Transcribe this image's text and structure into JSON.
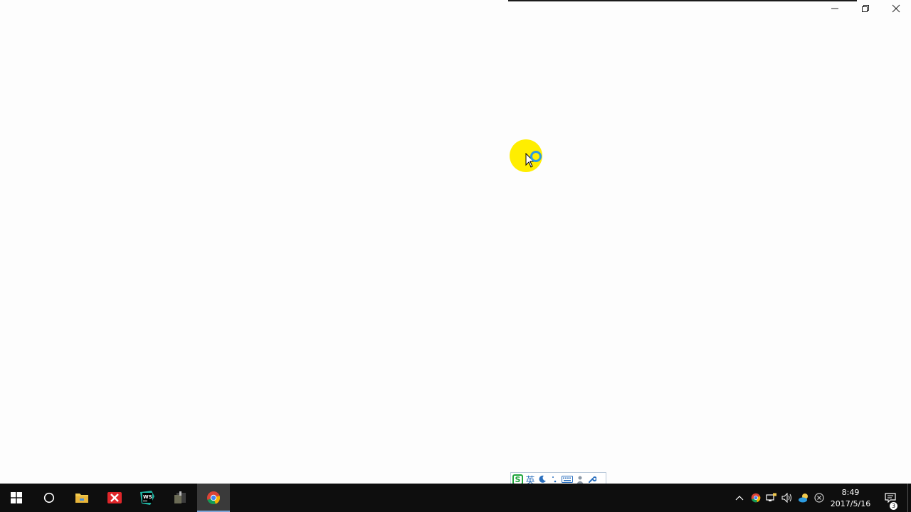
{
  "window": {
    "minimize_icon": "minimize-icon",
    "restore_icon": "restore-icon",
    "close_icon": "close-icon"
  },
  "ime": {
    "logo": "S",
    "language": "英",
    "icons": [
      "moon-icon",
      "punctuation-icon",
      "keyboard-icon",
      "user-icon",
      "wrench-icon"
    ]
  },
  "taskbar": {
    "apps": [
      "windows-start-icon",
      "cortana-icon",
      "file-explorer-icon",
      "xmind-icon",
      "webstorm-icon",
      "terminal-icon",
      "chrome-icon"
    ],
    "active_app": "chrome-icon",
    "webstorm_label": "WS",
    "clock": {
      "time": "8:49",
      "date": "2017/5/16"
    },
    "notification_count": "3"
  },
  "colors": {
    "taskbar": "#0e0e0e",
    "cursor_highlight": "#ffee00",
    "busy_ring": "#2c9be0"
  }
}
